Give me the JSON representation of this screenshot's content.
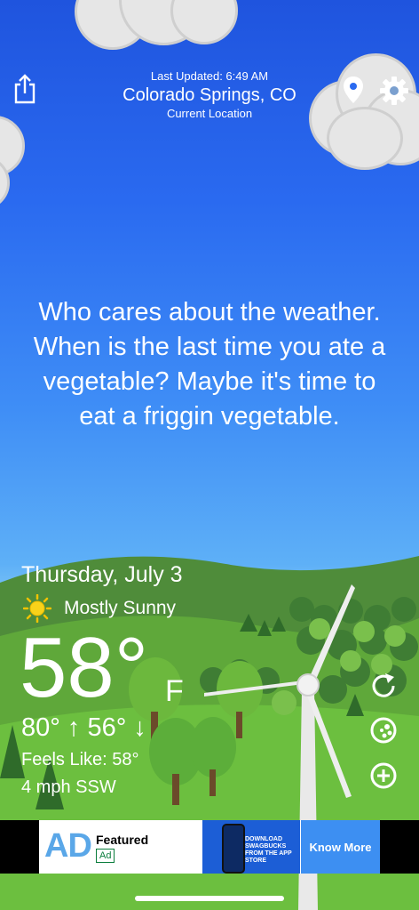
{
  "header": {
    "last_updated": "Last Updated: 6:49 AM",
    "city": "Colorado Springs, CO",
    "location_label": "Current Location"
  },
  "quote": "Who cares about the weather. When is the last time you ate a vegetable? Maybe it's time to eat a friggin vegetable.",
  "forecast": {
    "date": "Thursday, July 3",
    "condition": "Mostly Sunny",
    "temperature": "58°",
    "unit": "F",
    "high_low": "80° ↑  56° ↓",
    "feels_like": "Feels Like: 58°",
    "wind": "4 mph SSW"
  },
  "ad": {
    "mark": "AD",
    "featured": "Featured",
    "tag": "Ad",
    "image_text": "DOWNLOAD SWAGBUCKS FROM THE APP STORE",
    "cta": "Know More"
  },
  "icons": {
    "share": "share-icon",
    "location": "location-pin-icon",
    "settings": "gear-icon",
    "refresh": "refresh-icon",
    "radar": "radar-icon",
    "add": "plus-circle-icon",
    "sun": "sun-icon"
  },
  "colors": {
    "sky_top": "#1f54de",
    "sky_bottom": "#8fd0f4",
    "grass": "#5fa83a",
    "cloud": "#e6e6e6"
  }
}
